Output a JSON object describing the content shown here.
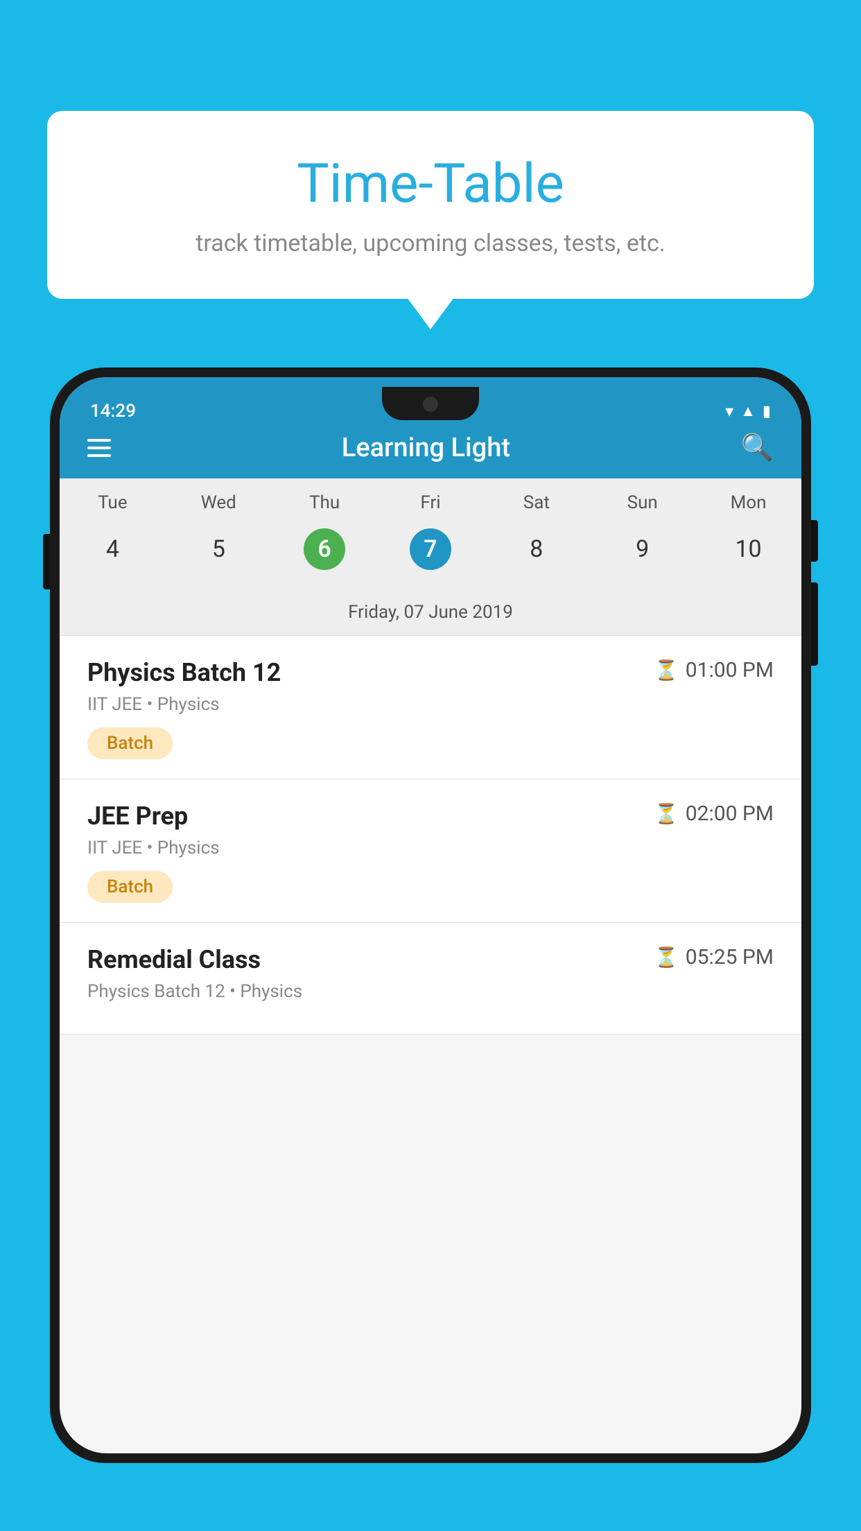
{
  "background_color": "#1ab9e8",
  "speech_bubble": {
    "title": "Time-Table",
    "subtitle": "track timetable, upcoming classes, tests, etc."
  },
  "app": {
    "header_title": "Learning Light",
    "status_bar": {
      "time": "14:29"
    }
  },
  "calendar": {
    "days": [
      {
        "label": "Tue",
        "number": "4"
      },
      {
        "label": "Wed",
        "number": "5"
      },
      {
        "label": "Thu",
        "number": "6",
        "state": "today"
      },
      {
        "label": "Fri",
        "number": "7",
        "state": "selected"
      },
      {
        "label": "Sat",
        "number": "8"
      },
      {
        "label": "Sun",
        "number": "9"
      },
      {
        "label": "Mon",
        "number": "10"
      }
    ],
    "selected_date_label": "Friday, 07 June 2019"
  },
  "schedule": [
    {
      "name": "Physics Batch 12",
      "time": "01:00 PM",
      "meta": "IIT JEE • Physics",
      "tag": "Batch"
    },
    {
      "name": "JEE Prep",
      "time": "02:00 PM",
      "meta": "IIT JEE • Physics",
      "tag": "Batch"
    },
    {
      "name": "Remedial Class",
      "time": "05:25 PM",
      "meta": "Physics Batch 12 • Physics",
      "tag": ""
    }
  ]
}
